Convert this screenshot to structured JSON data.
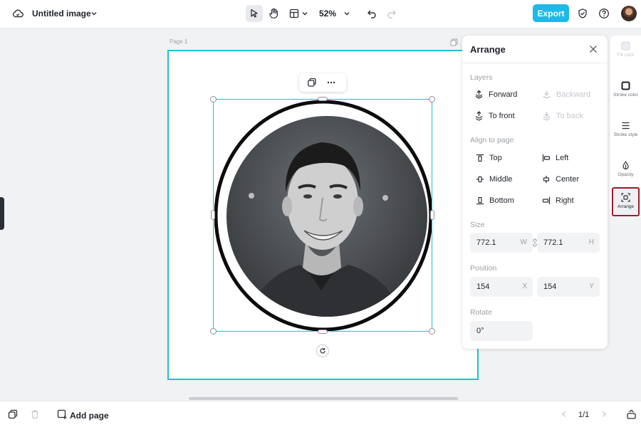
{
  "header": {
    "title": "Untitled image",
    "zoom": "52%",
    "export_label": "Export"
  },
  "canvas": {
    "page_label": "Page 1"
  },
  "arrange": {
    "title": "Arrange",
    "layers_label": "Layers",
    "layers": [
      {
        "label": "Forward",
        "icon": "forward-icon",
        "enabled": true
      },
      {
        "label": "Backward",
        "icon": "backward-icon",
        "enabled": false
      },
      {
        "label": "To front",
        "icon": "to-front-icon",
        "enabled": true
      },
      {
        "label": "To back",
        "icon": "to-back-icon",
        "enabled": false
      }
    ],
    "align_label": "Align to page",
    "align": [
      {
        "label": "Top",
        "icon": "align-top-icon"
      },
      {
        "label": "Left",
        "icon": "align-left-icon"
      },
      {
        "label": "Middle",
        "icon": "align-middle-icon"
      },
      {
        "label": "Center",
        "icon": "align-center-icon"
      },
      {
        "label": "Bottom",
        "icon": "align-bottom-icon"
      },
      {
        "label": "Right",
        "icon": "align-right-icon"
      }
    ],
    "size_label": "Size",
    "width_value": "772.1",
    "width_unit": "W",
    "height_value": "772.1",
    "height_unit": "H",
    "position_label": "Position",
    "x_value": "154",
    "x_unit": "X",
    "y_value": "154",
    "y_unit": "Y",
    "rotate_label": "Rotate",
    "rotate_value": "0°"
  },
  "rail": {
    "items": [
      {
        "label": "Fill color",
        "icon": "fill-color-icon",
        "enabled": false
      },
      {
        "label": "Stroke color",
        "icon": "stroke-color-icon",
        "enabled": true
      },
      {
        "label": "Stroke style",
        "icon": "stroke-style-icon",
        "enabled": true
      },
      {
        "label": "Opacity",
        "icon": "opacity-icon",
        "enabled": true
      },
      {
        "label": "Arrange",
        "icon": "arrange-icon",
        "enabled": true,
        "active": true
      }
    ]
  },
  "footer": {
    "add_page_label": "Add page",
    "page_count": "1/1"
  },
  "colors": {
    "accent": "#1db9e8",
    "selection": "#19c3d6",
    "active_rail_border": "#9b1b2a"
  }
}
